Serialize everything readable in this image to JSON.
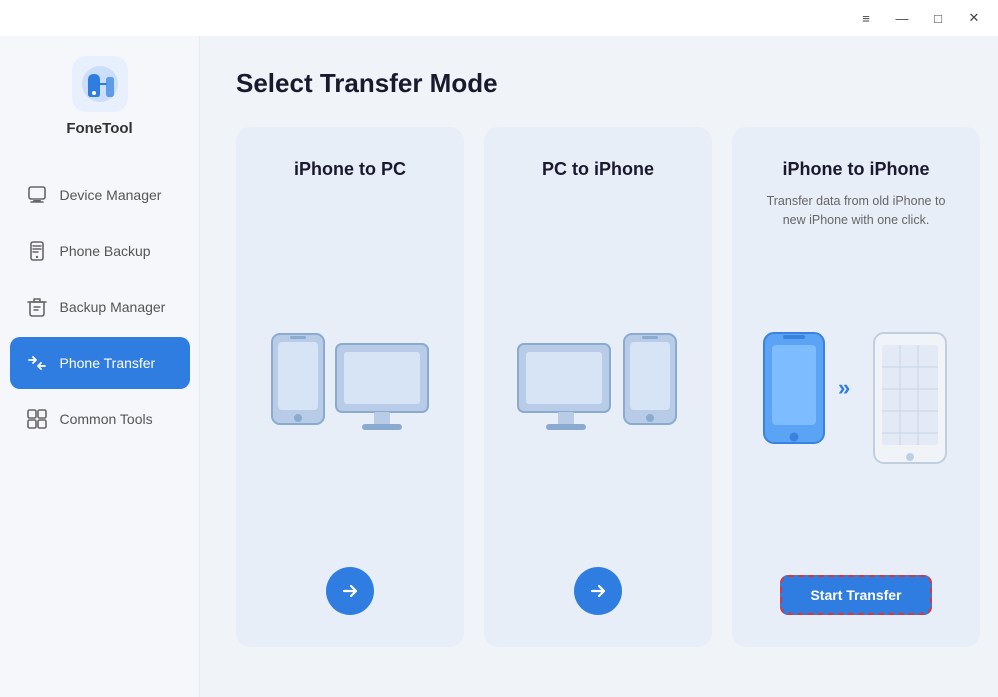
{
  "titlebar": {
    "menu_icon": "≡",
    "minimize_icon": "—",
    "maximize_icon": "□",
    "close_icon": "✕"
  },
  "sidebar": {
    "app_name": "FoneTool",
    "nav_items": [
      {
        "id": "device-manager",
        "label": "Device Manager",
        "active": false
      },
      {
        "id": "phone-backup",
        "label": "Phone Backup",
        "active": false
      },
      {
        "id": "backup-manager",
        "label": "Backup Manager",
        "active": false
      },
      {
        "id": "phone-transfer",
        "label": "Phone Transfer",
        "active": true
      },
      {
        "id": "common-tools",
        "label": "Common Tools",
        "active": false
      }
    ]
  },
  "main": {
    "page_title": "Select Transfer Mode",
    "cards": [
      {
        "id": "iphone-to-pc",
        "title": "iPhone to PC",
        "desc": "",
        "action_type": "arrow"
      },
      {
        "id": "pc-to-iphone",
        "title": "PC to iPhone",
        "desc": "",
        "action_type": "arrow"
      },
      {
        "id": "iphone-to-iphone",
        "title": "iPhone to iPhone",
        "desc": "Transfer data from old iPhone to new iPhone with one click.",
        "action_type": "start",
        "action_label": "Start Transfer"
      }
    ]
  },
  "colors": {
    "accent": "#2f7de1",
    "active_nav_bg": "#2f7de1",
    "card_bg": "#e8eef8",
    "title_color": "#1a1a2e",
    "dashed_border": "#e03535"
  }
}
